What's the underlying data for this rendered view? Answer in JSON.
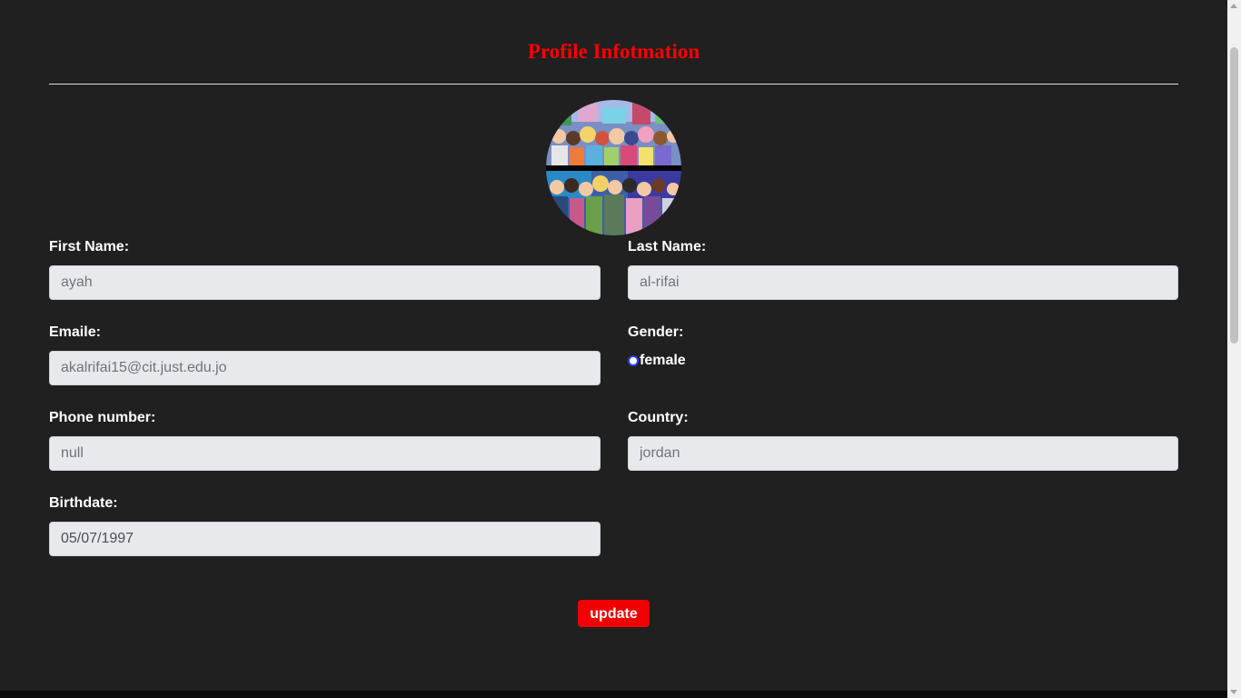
{
  "page": {
    "title": "Profile Infotmation"
  },
  "form": {
    "first_name": {
      "label": "First Name:",
      "placeholder": "ayah"
    },
    "last_name": {
      "label": "Last Name:",
      "placeholder": "al-rifai"
    },
    "email": {
      "label": "Emaile:",
      "placeholder": "akalrifai15@cit.just.edu.jo"
    },
    "gender": {
      "label": "Gender:",
      "option": "female",
      "selected": false
    },
    "phone": {
      "label": "Phone number:",
      "placeholder": "null"
    },
    "country": {
      "label": "Country:",
      "placeholder": "jordan"
    },
    "birthdate": {
      "label": "Birthdate:",
      "value": "05/07/1997"
    }
  },
  "actions": {
    "update_label": "update"
  },
  "colors": {
    "background": "#202020",
    "accent": "#ff0000",
    "button": "#f00000",
    "input_bg": "#e8e9ec",
    "radio_border": "#2a3bff"
  },
  "icons": {
    "avatar": "profile-avatar-image"
  }
}
